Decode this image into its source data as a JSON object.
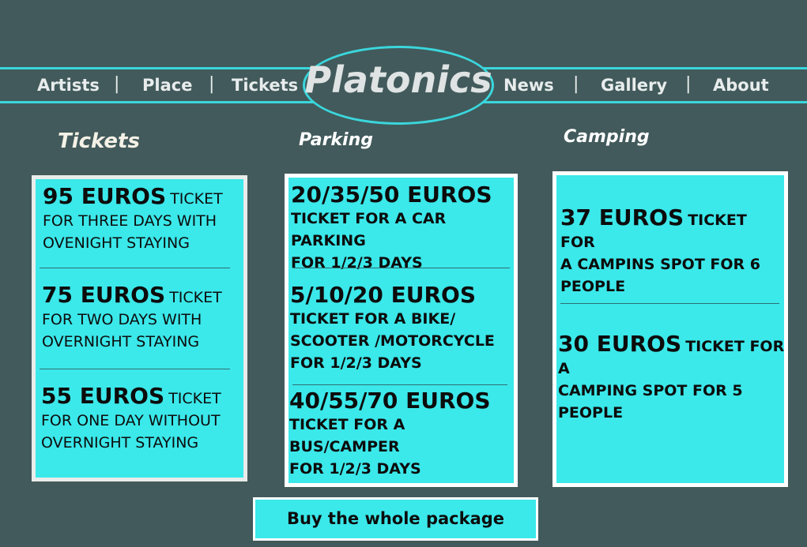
{
  "nav": {
    "left": [
      "Artists",
      "Place",
      "Tickets"
    ],
    "right": [
      "News",
      "Gallery",
      "About"
    ],
    "separator": "|",
    "logo": "Platonics"
  },
  "columns": {
    "tickets": {
      "title": "Tickets",
      "entries": [
        {
          "price": "95 EUROS",
          "suffix": "TICKET",
          "desc1": "FOR THREE DAYS WITH",
          "desc2": "OVENIGHT STAYING"
        },
        {
          "price": "75 EUROS",
          "suffix": "TICKET",
          "desc1": "FOR TWO DAYS WITH",
          "desc2": "OVERNIGHT STAYING"
        },
        {
          "price": "55 EUROS",
          "suffix": "TICKET",
          "desc1": "FOR ONE DAY WITHOUT",
          "desc2": "OVERNIGHT STAYING"
        }
      ]
    },
    "parking": {
      "title": "Parking",
      "entries": [
        {
          "price": "20/35/50 EUROS",
          "line1": "TICKET FOR A CAR PARKING",
          "line2": "FOR 1/2/3 DAYS"
        },
        {
          "price": "5/10/20 EUROS",
          "line1": "TICKET FOR A BIKE/",
          "line2": "SCOOTER /MOTORCYCLE",
          "line3": "FOR 1/2/3 DAYS"
        },
        {
          "price": "40/55/70 EUROS",
          "line1": "TICKET FOR A BUS/CAMPER",
          "line2": "FOR 1/2/3 DAYS"
        }
      ]
    },
    "camping": {
      "title": "Camping",
      "entries": [
        {
          "price": "37 EUROS",
          "suffix": "TICKET FOR",
          "line1": "A CAMPINS SPOT FOR 6",
          "line2": "PEOPLE"
        },
        {
          "price": "30 EUROS",
          "suffix": "TICKET FOR A",
          "line1": "CAMPING SPOT FOR 5",
          "line2": "PEOPLE"
        }
      ]
    }
  },
  "buy_button": "Buy the whole package",
  "colors": {
    "background": "#425a5b",
    "accent": "#3ad6dc",
    "box_fill": "#3be8ea"
  }
}
